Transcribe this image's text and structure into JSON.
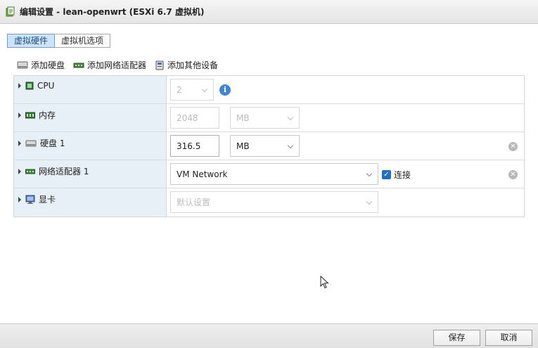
{
  "window": {
    "title": "编辑设置 - lean-openwrt (ESXi 6.7 虚拟机)"
  },
  "tabs": [
    {
      "label": "虚拟硬件",
      "active": true
    },
    {
      "label": "虚拟机选项",
      "active": false
    }
  ],
  "toolbar": {
    "add_disk": "添加硬盘",
    "add_network": "添加网络适配器",
    "add_other": "添加其他设备"
  },
  "hardware": {
    "cpu": {
      "label": "CPU",
      "value": "2"
    },
    "memory": {
      "label": "内存",
      "value": "2048",
      "unit": "MB"
    },
    "disk": {
      "label": "硬盘 1",
      "value": "316.5",
      "unit": "MB"
    },
    "network": {
      "label": "网络适配器 1",
      "value": "VM Network",
      "connect_label": "连接",
      "connected": true
    },
    "display": {
      "label": "显卡",
      "value": "默认设置"
    }
  },
  "footer": {
    "save_label": "保存",
    "cancel_label": "取消"
  },
  "colors": {
    "tab_active_bg": "#cfe3f8",
    "label_col_bg": "#e8f0f7",
    "info_blue": "#3b86d6",
    "checkbox_blue": "#1e6fc9"
  }
}
